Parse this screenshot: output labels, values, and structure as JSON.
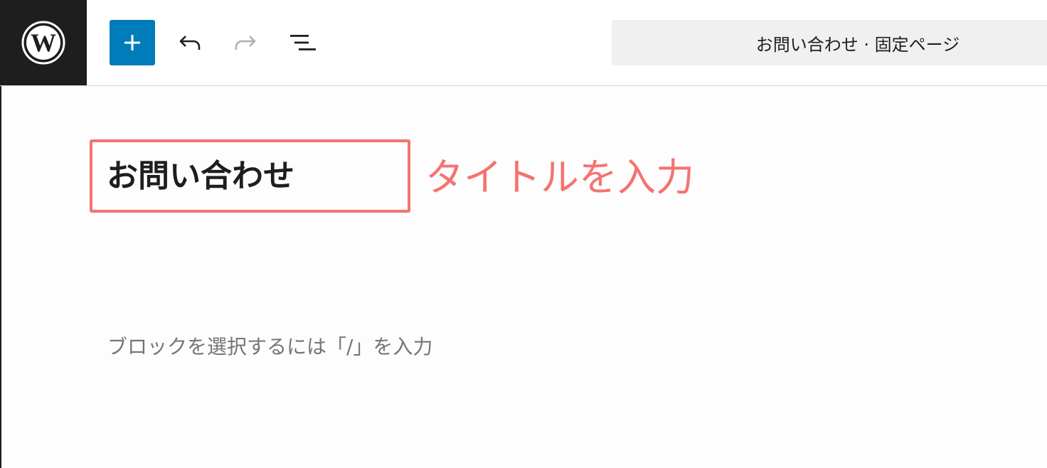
{
  "toolbar": {
    "logo_icon": "wordpress-logo-icon",
    "inserter_icon": "plus-icon",
    "undo_icon": "undo-icon",
    "redo_icon": "redo-icon",
    "list_view_icon": "list-view-icon",
    "document_title": "お問い合わせ · 固定ページ"
  },
  "editor": {
    "post_title": "お問い合わせ",
    "block_placeholder": "ブロックを選択するには「/」を入力"
  },
  "annotation": {
    "text": "タイトルを入力",
    "color": "#f4736f"
  },
  "colors": {
    "accent": "#007cba",
    "logo_tile": "#1e1e1e",
    "doc_bar": "#f0f0f0"
  }
}
